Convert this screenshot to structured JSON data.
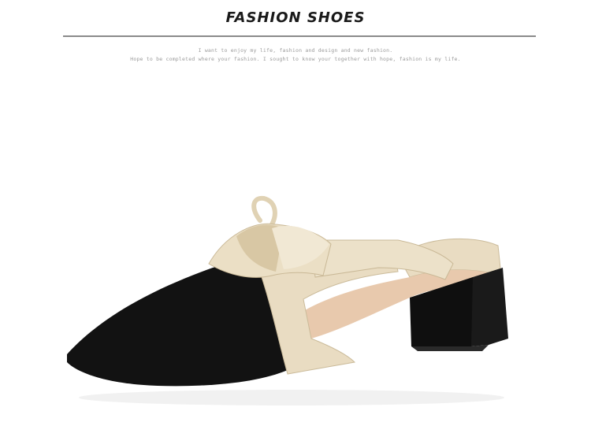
{
  "header": {
    "title": "FASHION SHOES",
    "tagline_line1": "I want to enjoy my life, fashion and design and new fashion.",
    "tagline_line2": "Hope to be completed where your fashion. I sought to know your together with hope, fashion is my life."
  },
  "product": {
    "image_subject": "pointed-toe block-heel mule with bow",
    "colors": {
      "suede": "#121212",
      "satin": "#e9dcc2",
      "satin_shadow": "#c9b896",
      "lining": "#e8c9ad",
      "heel": "#1a1a1a"
    }
  }
}
